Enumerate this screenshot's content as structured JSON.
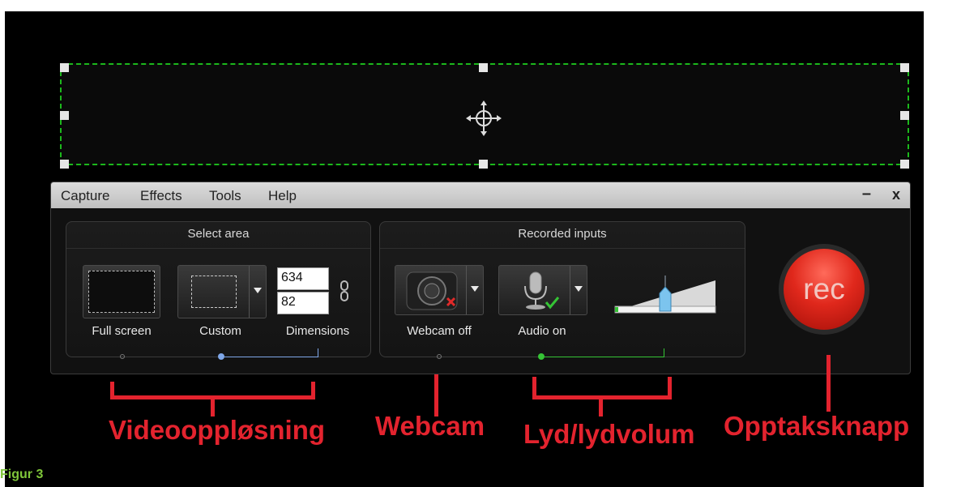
{
  "menu": {
    "items": [
      "Capture",
      "Effects",
      "Tools",
      "Help"
    ],
    "minimize": "–",
    "close": "x"
  },
  "select_area": {
    "title": "Select area",
    "full_screen_label": "Full screen",
    "custom_label": "Custom",
    "dimensions_label": "Dimensions",
    "width_value": "634",
    "height_value": "82"
  },
  "recorded_inputs": {
    "title": "Recorded inputs",
    "webcam_label": "Webcam off",
    "audio_label": "Audio on",
    "volume_level": 0.5
  },
  "rec_button": {
    "label": "rec"
  },
  "annotations": {
    "video_resolution": "Videooppløsning",
    "webcam": "Webcam",
    "audio_volume": "Lyd/lydvolum",
    "record_button": "Opptaksknapp"
  },
  "caption": "Figur 3",
  "colors": {
    "capture_border": "#1cb81c",
    "annotation": "#e3232e",
    "caption": "#7fc63a",
    "rec": "#d6231e"
  }
}
